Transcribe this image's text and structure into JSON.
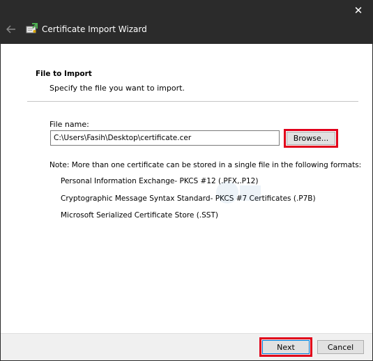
{
  "window": {
    "title": "Certificate Import Wizard",
    "close_glyph": "✕",
    "back_icon": "back-arrow-icon",
    "wizard_icon": "certificate-icon"
  },
  "page": {
    "section_title": "File to Import",
    "section_subtitle": "Specify the file you want to import."
  },
  "file": {
    "label": "File name:",
    "value": "C:\\Users\\Fasih\\Desktop\\certificate.cer",
    "browse_label": "Browse..."
  },
  "note": {
    "text": "Note:  More than one certificate can be stored in a single file in the following formats:",
    "formats": [
      "Personal Information Exchange- PKCS #12 (.PFX,.P12)",
      "Cryptographic Message Syntax Standard- PKCS #7 Certificates (.P7B)",
      "Microsoft Serialized Certificate Store (.SST)"
    ]
  },
  "footer": {
    "next_label": "Next",
    "cancel_label": "Cancel"
  },
  "colors": {
    "titlebar": "#2b2b2b",
    "highlight": "#e1001a",
    "button_face": "#e1e1e1",
    "footer": "#f0f0f0"
  }
}
